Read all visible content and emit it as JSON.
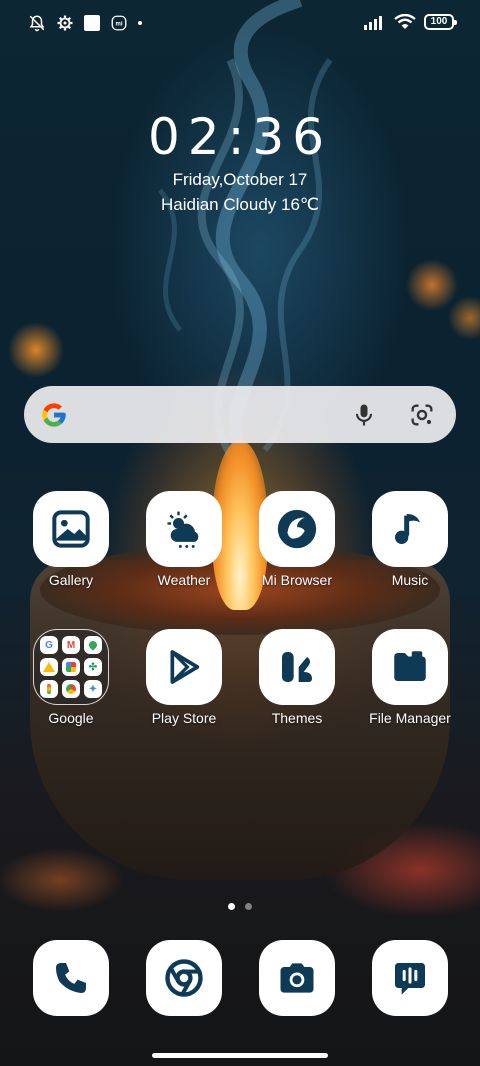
{
  "status_bar": {
    "left_icons": [
      "silent-bell-icon",
      "settings-gear-icon",
      "square-notification-icon",
      "mi-icon",
      "dot-icon"
    ],
    "right_icons": [
      "signal-icon",
      "wifi-icon"
    ],
    "battery_level": "100"
  },
  "clock_widget": {
    "time": "02:36",
    "date": "Friday,October 17",
    "weather": "Haidian Cloudy 16℃"
  },
  "search_bar": {
    "icons": [
      "google-g-icon",
      "mic-icon",
      "google-lens-icon"
    ]
  },
  "apps": [
    {
      "label": "Gallery",
      "icon": "gallery-icon"
    },
    {
      "label": "Weather",
      "icon": "weather-icon"
    },
    {
      "label": "Mi Browser",
      "icon": "mi-browser-icon"
    },
    {
      "label": "Music",
      "icon": "music-icon"
    },
    {
      "label": "Google",
      "icon": "google-folder-icon"
    },
    {
      "label": "Play Store",
      "icon": "play-store-icon"
    },
    {
      "label": "Themes",
      "icon": "themes-icon"
    },
    {
      "label": "File Manager",
      "icon": "file-manager-icon"
    }
  ],
  "google_folder_apps": [
    "G",
    "M",
    "maps",
    "drive",
    "photos",
    "pinwheel",
    "meet",
    "chrome",
    "gemini"
  ],
  "page_indicator": {
    "pages": 2,
    "active": 1
  },
  "dock": [
    {
      "name": "Phone",
      "icon": "phone-icon"
    },
    {
      "name": "Chrome",
      "icon": "chrome-icon"
    },
    {
      "name": "Camera",
      "icon": "camera-icon"
    },
    {
      "name": "Messages",
      "icon": "messages-icon"
    }
  ],
  "colors": {
    "icon_dark": "#0f3a55",
    "icon_bg": "#ffffff",
    "search_bg": "#ececee"
  }
}
